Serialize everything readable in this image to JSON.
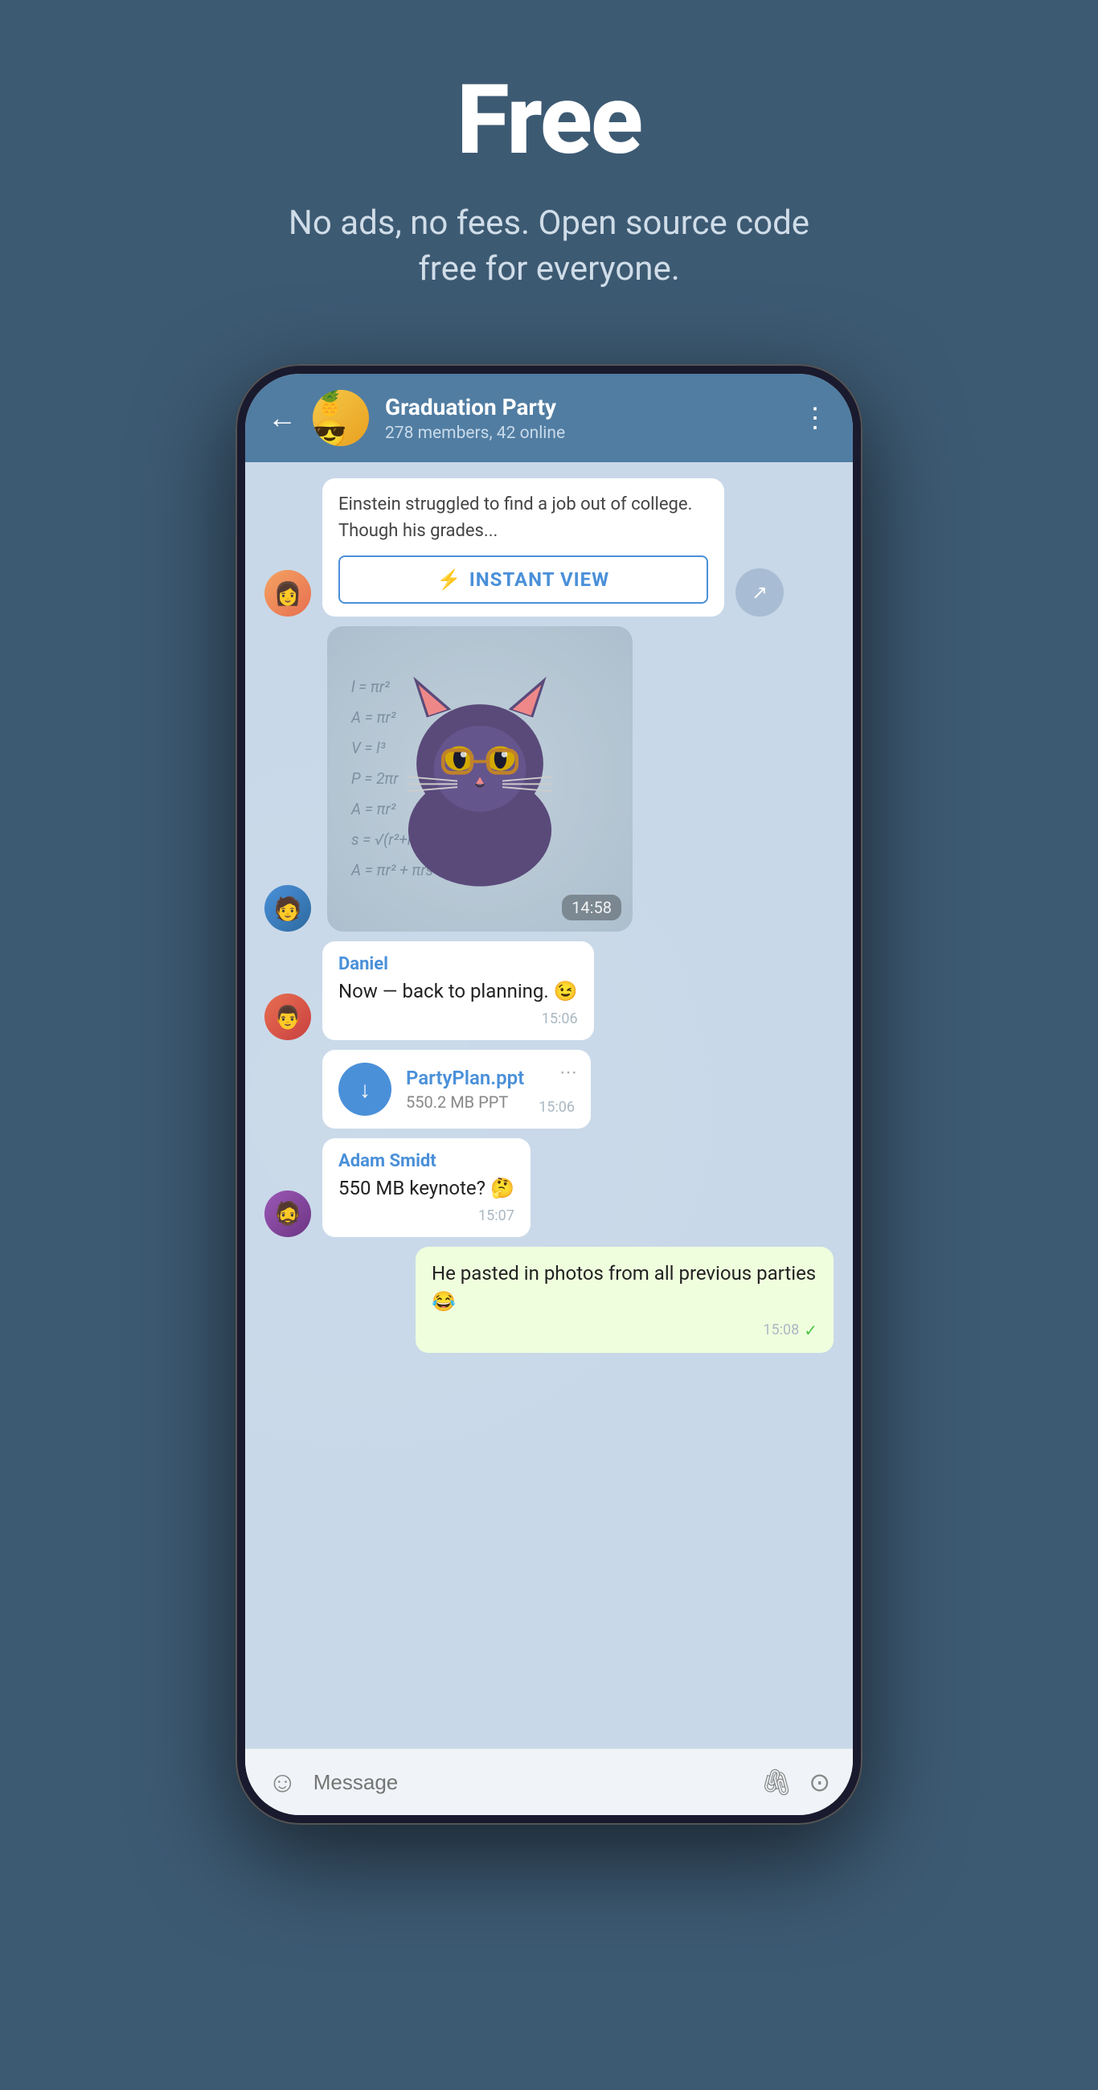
{
  "hero": {
    "title": "Free",
    "subtitle": "No ads, no fees. Open source code free for everyone."
  },
  "phone": {
    "header": {
      "back_label": "←",
      "group_name": "Graduation Party",
      "group_meta": "278 members, 42 online",
      "more_label": "⋮"
    },
    "messages": [
      {
        "id": "instant-view",
        "type": "instant_view",
        "text": "Einstein struggled to find a job out of college. Though his grades...",
        "button_label": "INSTANT VIEW"
      },
      {
        "id": "sticker",
        "type": "sticker",
        "time": "14:58"
      },
      {
        "id": "daniel-msg",
        "type": "incoming",
        "sender": "Daniel",
        "text": "Now — back to planning. 😉",
        "time": "15:06"
      },
      {
        "id": "file-msg",
        "type": "file",
        "filename": "PartyPlan.ppt",
        "filesize": "550.2 MB PPT",
        "time": "15:06"
      },
      {
        "id": "adam-msg",
        "type": "incoming",
        "sender": "Adam Smidt",
        "text": "550 MB keynote? 🤔",
        "time": "15:07"
      },
      {
        "id": "outgoing-msg",
        "type": "outgoing",
        "text": "He pasted in photos from all previous parties 😂",
        "time": "15:08",
        "sent": true
      }
    ],
    "bottom_bar": {
      "placeholder": "Message",
      "emoji_label": "☺",
      "attach_label": "📎",
      "camera_label": "◎"
    }
  }
}
